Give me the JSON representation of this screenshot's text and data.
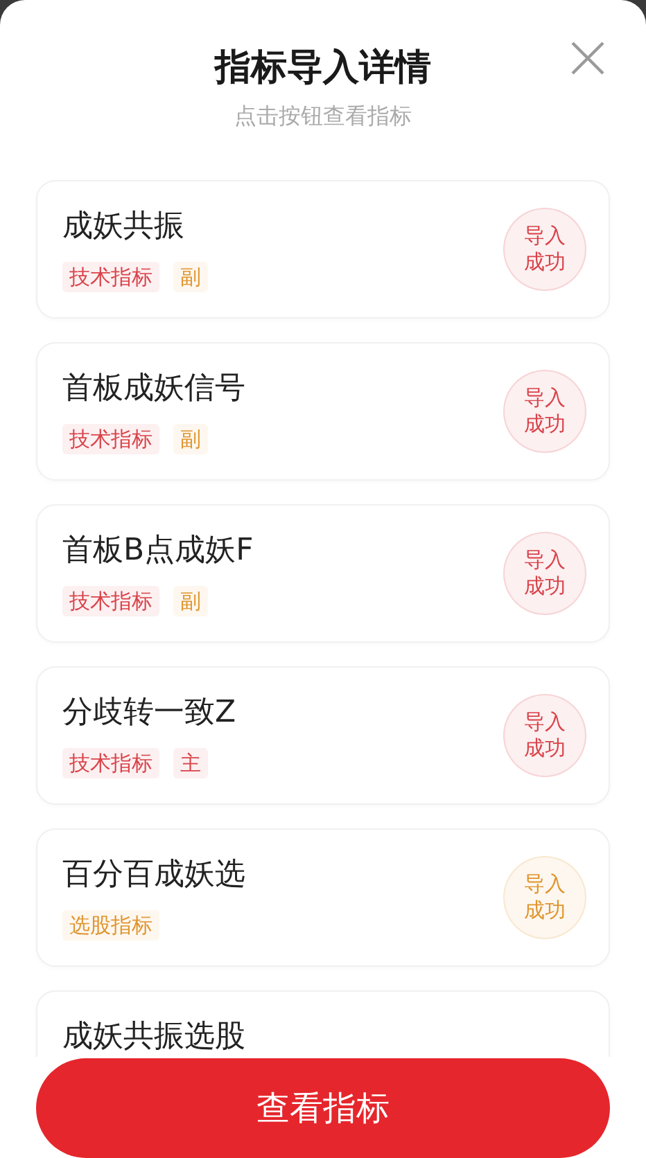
{
  "dialog": {
    "title": "指标导入详情",
    "subtitle": "点击按钮查看指标"
  },
  "items": [
    {
      "name": "成妖共振",
      "tags": [
        {
          "label": "技术指标",
          "color": "#d9434a"
        },
        {
          "label": "副",
          "color": "#e0952e"
        }
      ],
      "status": {
        "label": "导入成功",
        "color": "#d9434a"
      }
    },
    {
      "name": "首板成妖信号",
      "tags": [
        {
          "label": "技术指标",
          "color": "#d9434a"
        },
        {
          "label": "副",
          "color": "#e0952e"
        }
      ],
      "status": {
        "label": "导入成功",
        "color": "#d9434a"
      }
    },
    {
      "name": "首板B点成妖F",
      "tags": [
        {
          "label": "技术指标",
          "color": "#d9434a"
        },
        {
          "label": "副",
          "color": "#e0952e"
        }
      ],
      "status": {
        "label": "导入成功",
        "color": "#d9434a"
      }
    },
    {
      "name": "分歧转一致Z",
      "tags": [
        {
          "label": "技术指标",
          "color": "#d9434a"
        },
        {
          "label": "主",
          "color": "#d9434a"
        }
      ],
      "status": {
        "label": "导入成功",
        "color": "#d9434a"
      }
    },
    {
      "name": "百分百成妖选",
      "tags": [
        {
          "label": "选股指标",
          "color": "#e0952e"
        }
      ],
      "status": {
        "label": "导入成功",
        "color": "#e0952e"
      }
    },
    {
      "name": "成妖共振选股"
    }
  ],
  "footer": {
    "button": "查看指标"
  }
}
